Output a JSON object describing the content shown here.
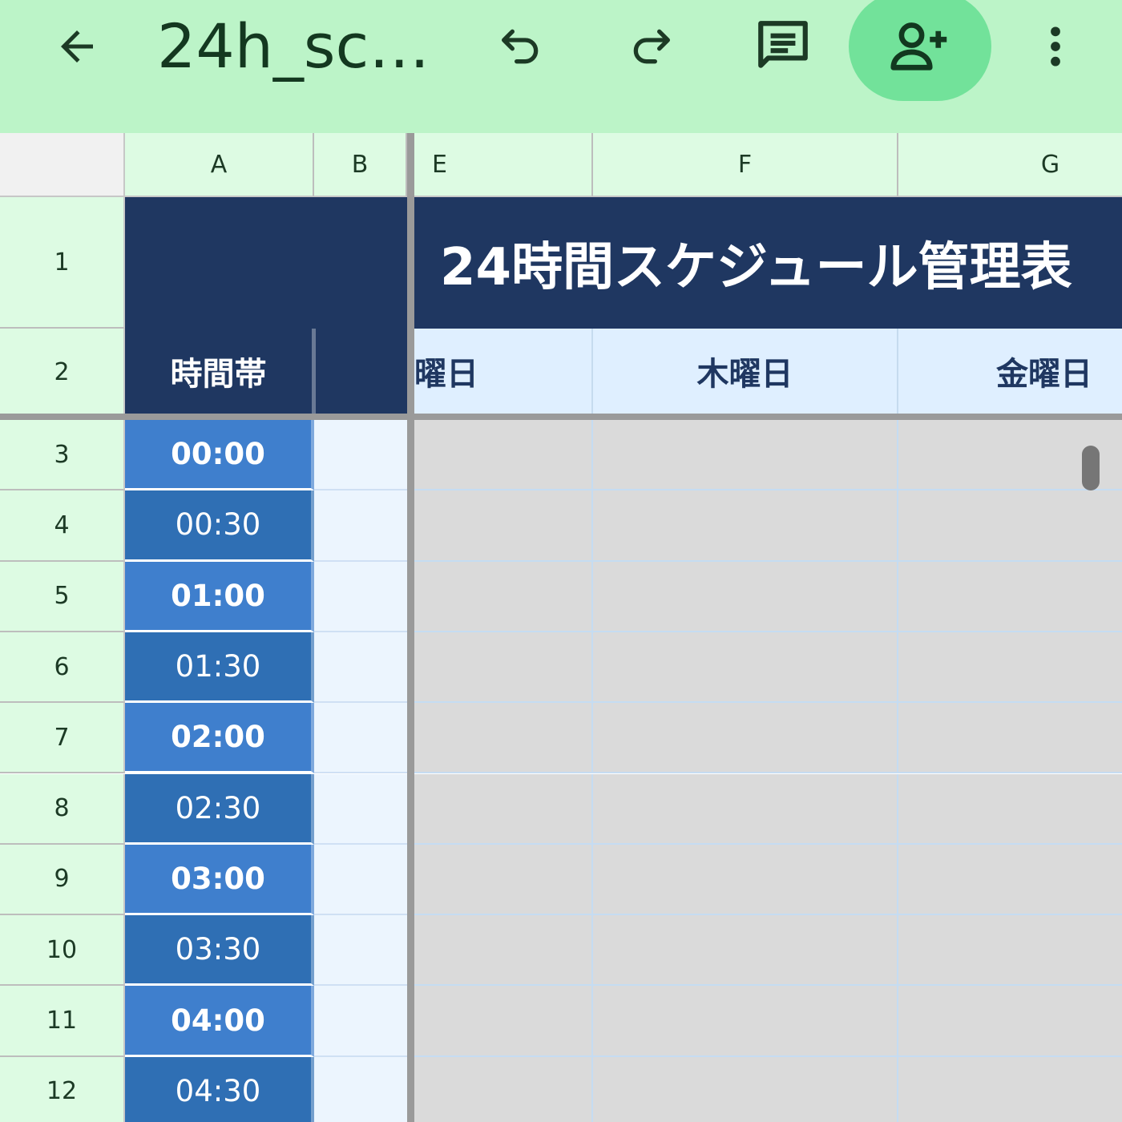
{
  "toolbar": {
    "title": "24h_sc…",
    "icons": [
      "back-arrow-icon",
      "undo-icon",
      "redo-icon",
      "comment-icon",
      "add-person-icon",
      "more-vert-icon"
    ],
    "share_bg": "#72e29a",
    "bar_bg": "#bcf4c8"
  },
  "columns": [
    "A",
    "B",
    "E",
    "F",
    "G"
  ],
  "rows": [
    "1",
    "2",
    "3",
    "4",
    "5",
    "6",
    "7",
    "8",
    "9",
    "10",
    "11",
    "12"
  ],
  "sheet": {
    "title": "24時間スケジュール管理表",
    "time_header": "時間帯",
    "days": [
      "水曜日",
      "木曜日",
      "金曜日"
    ],
    "times": [
      "00:00",
      "00:30",
      "01:00",
      "01:30",
      "02:00",
      "02:30",
      "03:00",
      "03:30",
      "04:00",
      "04:30"
    ]
  },
  "colors": {
    "navy": "#1f3761",
    "time_full": "#3f7fcd",
    "time_half": "#2f6fb4",
    "day_bg": "#dfefff",
    "empty_cell": "#dadada"
  }
}
